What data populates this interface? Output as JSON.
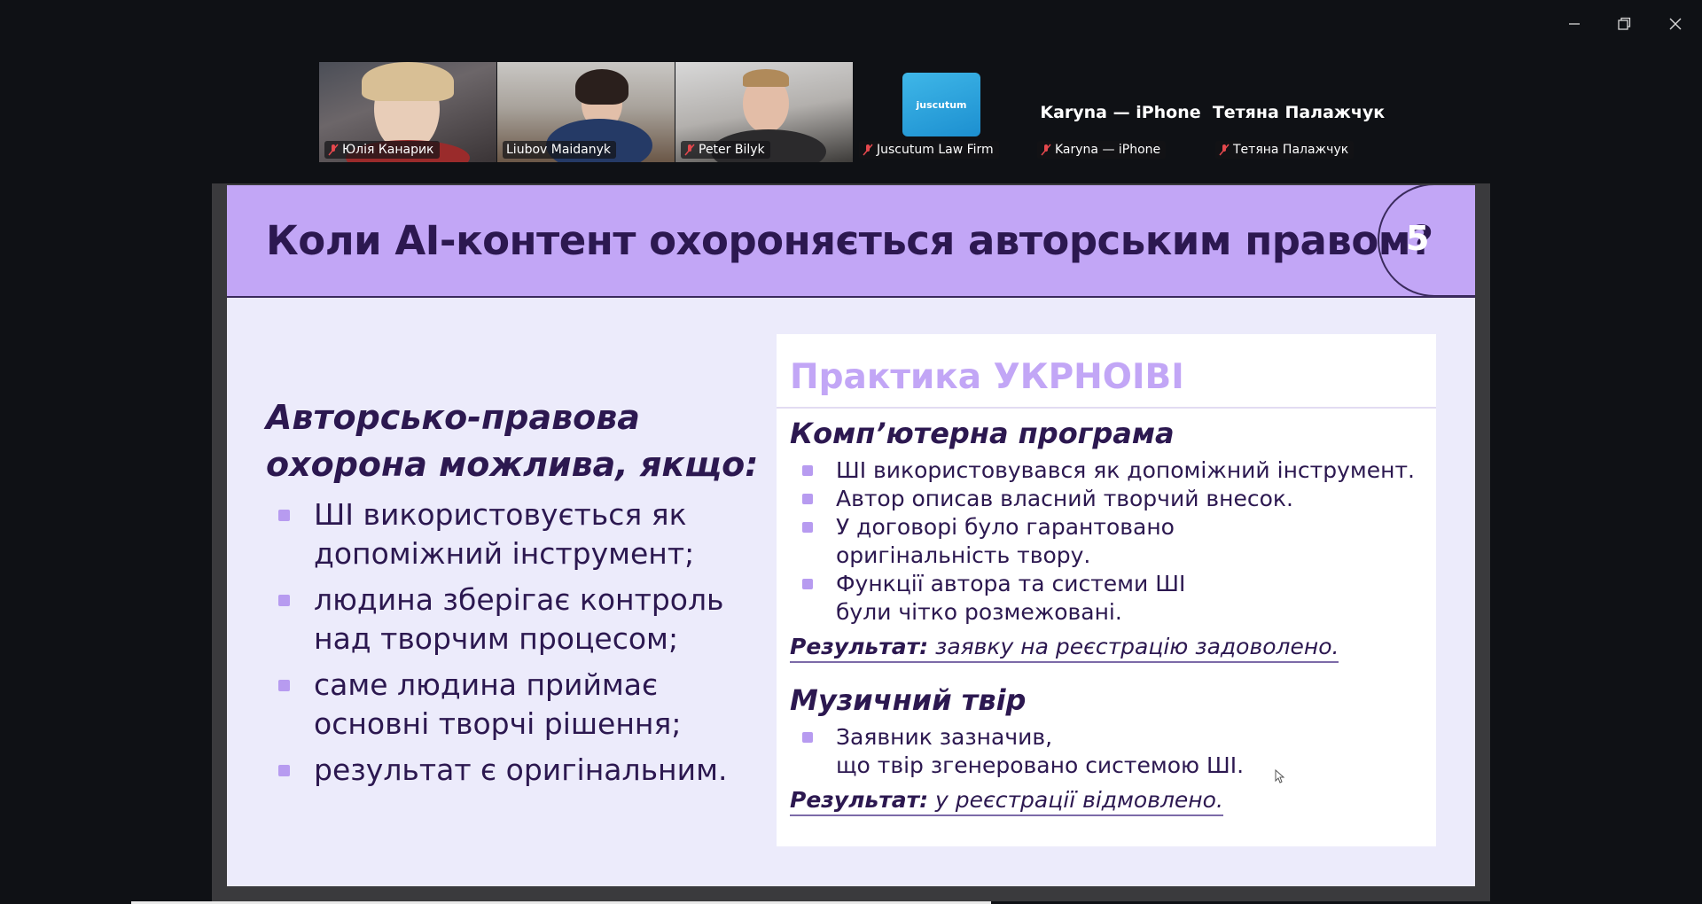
{
  "window_controls": {
    "minimize": "minimize-icon",
    "restore": "restore-icon",
    "close": "close-icon"
  },
  "participants": [
    {
      "name": "Юлія Канарик",
      "video": true,
      "muted": true
    },
    {
      "name": "Liubov Maidanyk",
      "video": true,
      "muted": true,
      "active_speaker": true
    },
    {
      "name": "Peter Bilyk",
      "video": true,
      "muted": true
    },
    {
      "name": "Juscutum Law Firm",
      "video": false,
      "muted": true,
      "logo_text": "juscutum"
    },
    {
      "name": "Karyna — iPhone",
      "video": false,
      "muted": true,
      "display_name": "Karyna — iPhone"
    },
    {
      "name": "Тетяна Палажчук",
      "video": false,
      "muted": true,
      "display_name": "Тетяна Палажчук"
    }
  ],
  "slide": {
    "title": "Коли AI-контент охороняється авторським правом?",
    "page_number": "5",
    "left": {
      "heading": "Авторсько-правова охорона можлива, якщо:",
      "bullets": [
        "ШІ використовується як допоміжний інструмент;",
        "людина зберігає контроль над творчим процесом;",
        "саме людина приймає основні творчі рішення;",
        "результат є оригінальним."
      ]
    },
    "card": {
      "title": "Практика УКРНОІВІ",
      "sections": [
        {
          "title": "Комп’ютерна програма",
          "bullets": [
            "ШІ використовувався як допоміжний інструмент.",
            "Автор описав власний творчий внесок.",
            "У договорі було гарантовано\nоригінальність твору.",
            "Функції автора та системи ШІ\nбули чітко розмежовані."
          ],
          "result_label": "Результат:",
          "result_text": " заявку на реєстрацію задоволено."
        },
        {
          "title": "Музичний твір",
          "bullets": [
            "Заявник зазначив,\nщо твір згенеровано системою ШІ."
          ],
          "result_label": "Результат:",
          "result_text": " у реєстрації відмовлено."
        }
      ]
    }
  },
  "colors": {
    "header_purple": "#c2a6f6",
    "text_dark": "#2c1850",
    "active_speaker": "#2ee68e",
    "muted_mic": "#e5484d"
  }
}
